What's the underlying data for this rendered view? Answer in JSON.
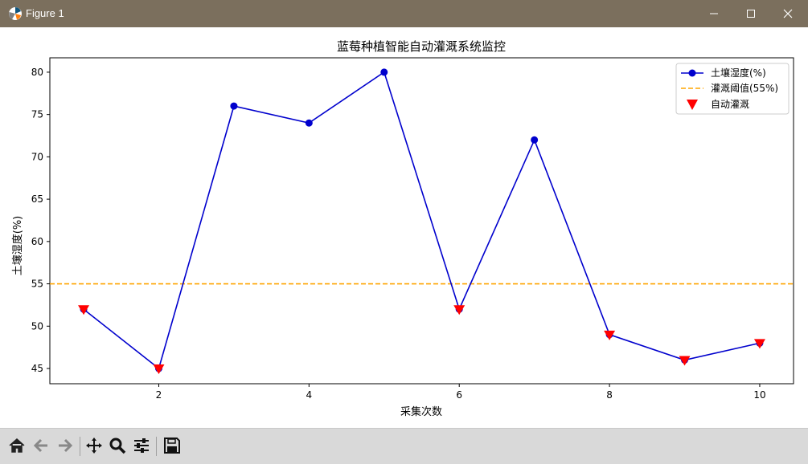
{
  "window": {
    "title": "Figure 1"
  },
  "toolbar": {
    "buttons": [
      "home-icon",
      "back-icon",
      "forward-icon",
      "pan-icon",
      "zoom-icon",
      "configure-subplots-icon",
      "save-icon"
    ]
  },
  "chart_data": {
    "type": "line",
    "title": "蓝莓种植智能自动灌溉系统监控",
    "xlabel": "采集次数",
    "ylabel": "土壤湿度(%)",
    "x": [
      1,
      2,
      3,
      4,
      5,
      6,
      7,
      8,
      9,
      10
    ],
    "xticks": [
      "2",
      "4",
      "6",
      "8",
      "10"
    ],
    "yticks": [
      "45",
      "50",
      "55",
      "60",
      "65",
      "70",
      "75",
      "80"
    ],
    "xlim": [
      0.55,
      10.45
    ],
    "ylim": [
      43.2,
      81.7
    ],
    "series": [
      {
        "name": "土壤湿度(%)",
        "values": [
          52,
          45,
          76,
          74,
          80,
          52,
          72,
          49,
          46,
          48
        ],
        "color": "#0000cd",
        "marker": "circle"
      }
    ],
    "threshold": {
      "name": "灌溉阈值(55%)",
      "value": 55,
      "color": "#ffa500",
      "style": "dashed"
    },
    "irrigation_events": {
      "name": "自动灌溉",
      "x": [
        1,
        2,
        6,
        8,
        9,
        10
      ],
      "y": [
        52,
        45,
        52,
        49,
        46,
        48
      ],
      "color": "#ff0000",
      "marker": "triangle-down"
    },
    "legend_position": "top-right",
    "grid": false
  }
}
